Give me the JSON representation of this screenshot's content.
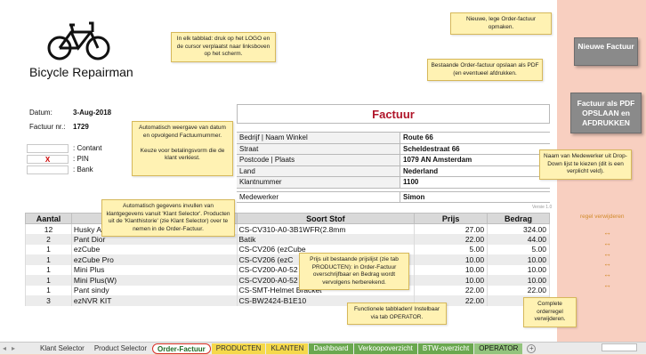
{
  "logo": {
    "name": "Bicycle Repairman",
    "icon": "bicycle-icon"
  },
  "invoice": {
    "title": "Factuur",
    "datum_label": "Datum:",
    "datum_value": "3-Aug-2018",
    "nummer_label": "Factuur nr.:",
    "nummer_value": "1729"
  },
  "payment": [
    {
      "mark": "",
      "label": ": Contant"
    },
    {
      "mark": "X",
      "label": ": PIN"
    },
    {
      "mark": "",
      "label": ": Bank"
    }
  ],
  "customer": [
    {
      "key": "Bedrijf    |    Naam Winkel",
      "value": "Route 66"
    },
    {
      "key": "Straat",
      "value": "Scheldestraat 66"
    },
    {
      "key": "Postcode    |    Plaats",
      "value": "1079 AN  Amsterdam"
    },
    {
      "key": "Land",
      "value": "Nederland"
    },
    {
      "key": "Klantnummer",
      "value": "1100"
    }
  ],
  "medewerker": {
    "key": "Medewerker",
    "value": "Simon"
  },
  "versie": "Versie 1.0",
  "table": {
    "headers": {
      "aantal": "Aantal",
      "soort": "Soort Stof",
      "prijs": "Prijs",
      "bedrag": "Bedrag"
    },
    "rows": [
      {
        "aantal": "12",
        "product": "Husky Ar",
        "code": "CS-CV310-A0-3B1WFR(2.8mm",
        "prijs": "27.00",
        "bedrag": "324.00"
      },
      {
        "aantal": "2",
        "product": "Pant Dior",
        "code": "Batik",
        "prijs": "22.00",
        "bedrag": "44.00"
      },
      {
        "aantal": "1",
        "product": "ezCube",
        "code": "CS-CV206 (ezCube",
        "prijs": "5.00",
        "bedrag": "5.00"
      },
      {
        "aantal": "1",
        "product": "ezCube Pro",
        "code": "CS-CV206   (ezC",
        "prijs": "10.00",
        "bedrag": "10.00"
      },
      {
        "aantal": "1",
        "product": "Mini Plus",
        "code": "CS-CV200-A0-52",
        "prijs": "10.00",
        "bedrag": "10.00"
      },
      {
        "aantal": "1",
        "product": "Mini Plus(W)",
        "code": "CS-CV200-A0-52",
        "prijs": "10.00",
        "bedrag": "10.00"
      },
      {
        "aantal": "1",
        "product": "Pant sindy",
        "code": "CS-SMT-Helmet Bracket",
        "prijs": "22.00",
        "bedrag": "22.00"
      },
      {
        "aantal": "3",
        "product": "ezNVR KIT",
        "code": "CS-BW2424-B1E10",
        "prijs": "22.00",
        "bedrag": ""
      }
    ]
  },
  "notes": {
    "logo": "In elk tabblad: druk op het LOGO en de cursor verplaatst naar linksboven op het scherm.",
    "nieuw": "Nieuwe, lege Order-factuur opmaken.",
    "pdf": "Bestaande Order-factuur opslaan als PDF (en eventueel afdrukken.",
    "datum": "Automatisch weergave van datum en opvolgend Factuurnummer.\n\nKeuze voor betalingsvorm die de klant verkiest.",
    "medewerker": "Naam van Medewerker uit Drop-Down lijst te kiezen (dit is een verplicht veld).",
    "klant": "Automatisch gegevens invullen van klantgegevens vanuit 'Klant Selector'. Producten uit de 'Klanthistorie' (zie Klant Selector) over te nemen in de Order-Factuur.",
    "prijs": "Prijs uit bestaande prijslijst (zie tab PRODUCTEN): in Order-Factuur overschrijfbaar en Bedrag wordt vervolgens herberekend.",
    "tabbladen": "Functionele tabbladen! Instelbaar via tab OPERATOR.",
    "orderregel": "Complete orderregel verwijderen."
  },
  "buttons": {
    "nieuwe_factuur": "Nieuwe Factuur",
    "pdf": "Factuur als PDF OPSLAAN en AFDRUKKEN"
  },
  "regel_verwijderen": "regel verwijderen",
  "arrow_glyph": "↔",
  "tabs": [
    "Klant Selector",
    "Product Selector",
    "Order-Factuur",
    "PRODUCTEN",
    "KLANTEN",
    "Dashboard",
    "Verkoopoverzicht",
    "BTW-overzicht",
    "OPERATOR"
  ],
  "colors": {
    "title_red": "#b0152a",
    "note_yellow": "#fff2b3",
    "side_pink": "#f8cfc0",
    "button_gray": "#8a8a8a",
    "arrow_orange": "#d18a2a"
  }
}
